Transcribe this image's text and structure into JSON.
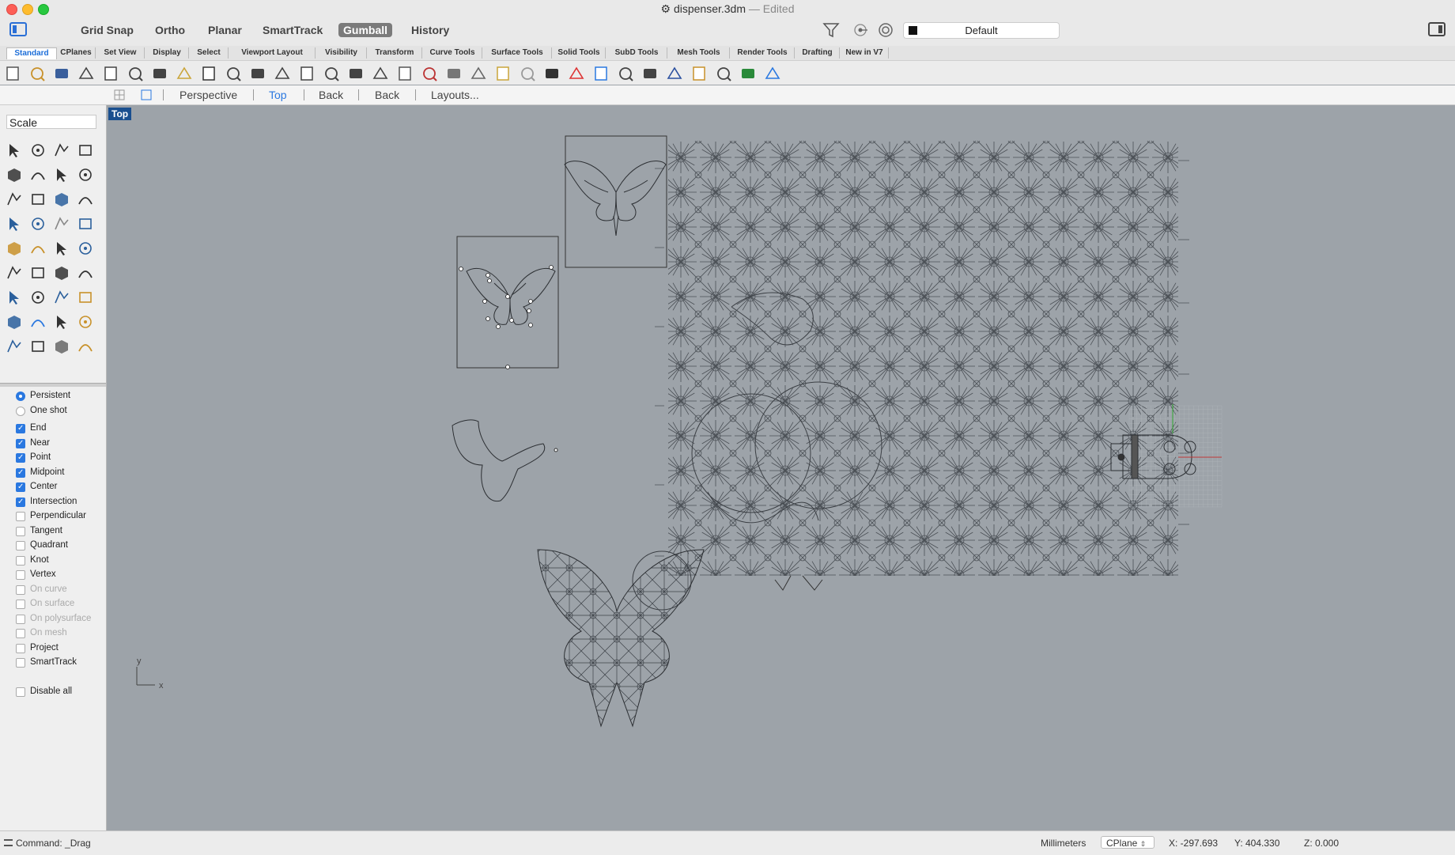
{
  "window": {
    "title": "dispenser.3dm",
    "edited": "— Edited"
  },
  "modes": [
    "Grid Snap",
    "Ortho",
    "Planar",
    "SmartTrack",
    "Gumball",
    "History"
  ],
  "active_mode": "Gumball",
  "layer": "Default",
  "tabs": [
    "Standard",
    "CPlanes",
    "Set View",
    "Display",
    "Select",
    "Viewport Layout",
    "Visibility",
    "Transform",
    "Curve Tools",
    "Surface Tools",
    "Solid Tools",
    "SubD Tools",
    "Mesh Tools",
    "Render Tools",
    "Drafting",
    "New in V7"
  ],
  "active_tab": "Standard",
  "toolbar_icons": [
    "new-icon",
    "open-icon",
    "save-icon",
    "print-icon",
    "import-icon",
    "cut-icon",
    "copy-icon",
    "paste-icon",
    "undo-icon",
    "pan-icon",
    "rotate-view-icon",
    "zoom-icon",
    "zoom-window-icon",
    "zoom-extents-icon",
    "zoom-selected-icon",
    "undo-view-icon",
    "four-viewports-icon",
    "car-icon",
    "grid-icon",
    "object-properties-icon",
    "layers-icon",
    "light-icon",
    "lock-icon",
    "hide-icon",
    "color-wheel-icon",
    "shaded-sphere-icon",
    "wireframe-sphere-icon",
    "rendered-sphere-icon",
    "pin-icon",
    "analyze-icon",
    "globe-icon",
    "help-icon"
  ],
  "viewport_tabs": [
    "Perspective",
    "Top",
    "Back",
    "Back",
    "Layouts..."
  ],
  "active_viewport_tab": "Top",
  "viewport_label": "Top",
  "command_input": "Scale",
  "tools": [
    "select-icon",
    "point-icon",
    "polyline-icon",
    "rectangle-icon",
    "circle-icon",
    "ellipse-icon",
    "polygon-icon",
    "rectangle-3pt-icon",
    "arc-icon",
    "fillet-curve-icon",
    "surface-icon",
    "surface-edit-icon",
    "box-icon",
    "sphere-icon",
    "cylinder-icon",
    "extrude-icon",
    "boolean-icon",
    "offset-icon",
    "trim-icon",
    "split-icon",
    "group-icon",
    "join-icon",
    "blend-icon",
    "fillet-icon",
    "text-icon",
    "dimension-icon",
    "array-icon",
    "gumball-icon",
    "solid-tools-icon",
    "hatch-icon",
    "grid-array-icon",
    "transform-icon",
    "solid-face-icon",
    "check-icon",
    "mesh-icon",
    "render-icon"
  ],
  "osnap": {
    "mode_options": [
      {
        "label": "Persistent",
        "checked": true
      },
      {
        "label": "One shot",
        "checked": false
      }
    ],
    "snaps": [
      {
        "label": "End",
        "checked": true,
        "enabled": true
      },
      {
        "label": "Near",
        "checked": true,
        "enabled": true
      },
      {
        "label": "Point",
        "checked": true,
        "enabled": true
      },
      {
        "label": "Midpoint",
        "checked": true,
        "enabled": true
      },
      {
        "label": "Center",
        "checked": true,
        "enabled": true
      },
      {
        "label": "Intersection",
        "checked": true,
        "enabled": true
      },
      {
        "label": "Perpendicular",
        "checked": false,
        "enabled": true
      },
      {
        "label": "Tangent",
        "checked": false,
        "enabled": true
      },
      {
        "label": "Quadrant",
        "checked": false,
        "enabled": true
      },
      {
        "label": "Knot",
        "checked": false,
        "enabled": true
      },
      {
        "label": "Vertex",
        "checked": false,
        "enabled": true
      },
      {
        "label": "On curve",
        "checked": false,
        "enabled": false
      },
      {
        "label": "On surface",
        "checked": false,
        "enabled": false
      },
      {
        "label": "On polysurface",
        "checked": false,
        "enabled": false
      },
      {
        "label": "On mesh",
        "checked": false,
        "enabled": false
      },
      {
        "label": "Project",
        "checked": false,
        "enabled": true
      },
      {
        "label": "SmartTrack",
        "checked": false,
        "enabled": true
      }
    ],
    "disable_all": {
      "label": "Disable all",
      "checked": false
    }
  },
  "axis_labels": {
    "x": "x",
    "y": "y"
  },
  "status": {
    "command": "Command: _Drag",
    "units": "Millimeters",
    "cplane": "CPlane",
    "x": "X: -297.693",
    "y": "Y: 404.330",
    "z": "Z: 0.000"
  },
  "colors": {
    "accent": "#2a78e0",
    "viewport_bg": "#9da3a9",
    "viewport_label_bg": "#1a4f8f"
  }
}
